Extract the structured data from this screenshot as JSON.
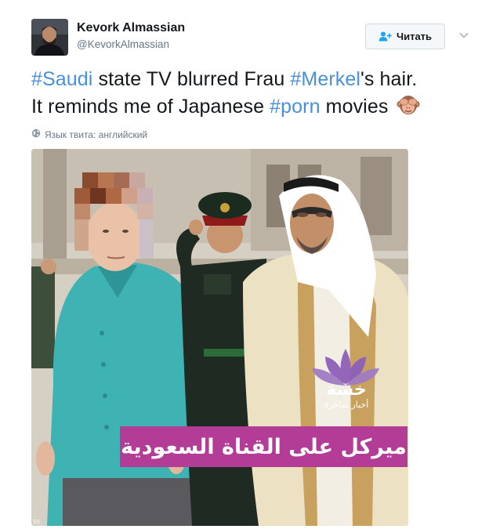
{
  "author": {
    "name": "Kevork Almassian",
    "handle": "@KevorkAlmassian"
  },
  "follow_button": {
    "label": "Читать",
    "icon": "add-user-icon"
  },
  "menu_icon": "chevron-down-icon",
  "tweet": {
    "hashtag1": "#Saudi",
    "text1": " state TV blurred Frau ",
    "hashtag2": "#Merkel",
    "text2": "'s hair.",
    "text3": "It reminds me of Japanese ",
    "hashtag3": "#porn",
    "text4": " movies",
    "emoji": "see-no-evil-monkey-emoji"
  },
  "language_note": {
    "icon": "globe-icon",
    "text": "Язык твита: английский"
  },
  "photo": {
    "caption_arabic": "ميركل على القناة السعودية",
    "logo_main": "خسة",
    "logo_sub": "أخبار ساخرة",
    "watermark": "ss",
    "colors": {
      "caption_bar": "#b23c96",
      "logo_lotus": "#8e5fb8",
      "jacket": "#3fb2b4"
    }
  },
  "colors": {
    "hashtag": "#4a90d9",
    "secondary_text": "#657786"
  }
}
